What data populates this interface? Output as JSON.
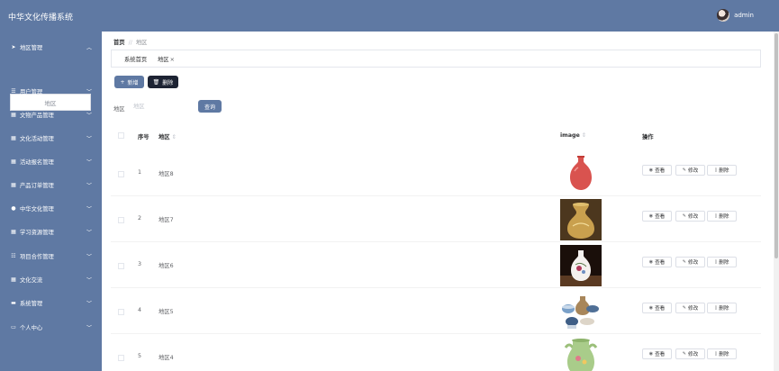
{
  "app": {
    "title": "中华文化传播系统",
    "user": "admin"
  },
  "sidebar": {
    "items": [
      {
        "label": "地区管理",
        "icon": "send-icon",
        "glyph": "➤",
        "expanded": true,
        "sub": [
          "地区"
        ]
      },
      {
        "label": "用户管理",
        "icon": "list-icon",
        "glyph": "☰"
      },
      {
        "label": "文物产品管理",
        "icon": "grid-icon",
        "glyph": "▦"
      },
      {
        "label": "文化活动管理",
        "icon": "grid-icon",
        "glyph": "▦"
      },
      {
        "label": "活动报名管理",
        "icon": "grid-icon",
        "glyph": "▦"
      },
      {
        "label": "产品订单管理",
        "icon": "grid-icon",
        "glyph": "▦"
      },
      {
        "label": "中华文化管理",
        "icon": "user-icon",
        "glyph": "●"
      },
      {
        "label": "学习资源管理",
        "icon": "grid-icon",
        "glyph": "▦"
      },
      {
        "label": "项目合作管理",
        "icon": "sliders-icon",
        "glyph": "☷"
      },
      {
        "label": "文化交流",
        "icon": "grid-icon",
        "glyph": "▦"
      },
      {
        "label": "系统管理",
        "icon": "chat-icon",
        "glyph": "▬"
      },
      {
        "label": "个人中心",
        "icon": "monitor-icon",
        "glyph": "▭"
      }
    ]
  },
  "breadcrumb": {
    "home": "首页",
    "separator": "//",
    "current": "地区"
  },
  "tabs": [
    {
      "label": "系统首页"
    },
    {
      "label": "地区",
      "close": "×"
    }
  ],
  "toolbar": {
    "add_label": "新增",
    "delete_label": "删除",
    "add_icon": "+",
    "delete_icon": "🗑"
  },
  "search": {
    "label": "地区",
    "placeholder": "地区",
    "button_label": "查询"
  },
  "table": {
    "headers": {
      "index": "序号",
      "region": "地区",
      "image": "image",
      "actions": "操作",
      "sort": "⇕"
    },
    "actions": {
      "view": "查看",
      "edit": "修改",
      "delete": "删除"
    },
    "rows": [
      {
        "index": "1",
        "region": "地区8",
        "image": "red-vase"
      },
      {
        "index": "2",
        "region": "地区7",
        "image": "gold-vase"
      },
      {
        "index": "3",
        "region": "地区6",
        "image": "painted-vase"
      },
      {
        "index": "4",
        "region": "地区5",
        "image": "ceramic-set"
      },
      {
        "index": "5",
        "region": "地区4",
        "image": "green-vase"
      }
    ]
  },
  "colors": {
    "primary": "#5f79a3",
    "dark": "#1d2333"
  }
}
